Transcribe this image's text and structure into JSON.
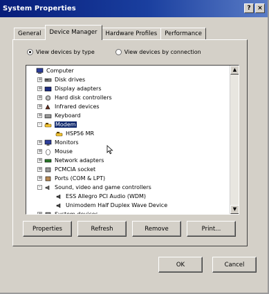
{
  "window": {
    "title": "System Properties",
    "help_label": "?",
    "close_label": "×"
  },
  "tabs": [
    {
      "label": "General"
    },
    {
      "label": "Device Manager"
    },
    {
      "label": "Hardware Profiles"
    },
    {
      "label": "Performance"
    }
  ],
  "view": {
    "by_type": "View devices by type",
    "by_connection": "View devices by connection"
  },
  "tree": {
    "items": [
      {
        "label": "Computer",
        "icon": "computer-icon",
        "expander": ""
      },
      {
        "label": "Disk drives",
        "icon": "disk-drive-icon",
        "expander": "+"
      },
      {
        "label": "Display adapters",
        "icon": "display-adapter-icon",
        "expander": "+"
      },
      {
        "label": "Hard disk controllers",
        "icon": "hard-disk-controller-icon",
        "expander": "+"
      },
      {
        "label": "Infrared devices",
        "icon": "infrared-icon",
        "expander": "+"
      },
      {
        "label": "Keyboard",
        "icon": "keyboard-icon",
        "expander": "+"
      },
      {
        "label": "Modem",
        "icon": "modem-icon",
        "expander": "-",
        "selected": true
      },
      {
        "label": "HSP56 MR",
        "icon": "modem-icon",
        "expander": ""
      },
      {
        "label": "Monitors",
        "icon": "monitor-icon",
        "expander": "+"
      },
      {
        "label": "Mouse",
        "icon": "mouse-icon",
        "expander": "+"
      },
      {
        "label": "Network adapters",
        "icon": "network-adapter-icon",
        "expander": "+"
      },
      {
        "label": "PCMCIA socket",
        "icon": "pcmcia-icon",
        "expander": "+"
      },
      {
        "label": "Ports (COM & LPT)",
        "icon": "port-icon",
        "expander": "+"
      },
      {
        "label": "Sound, video and game controllers",
        "icon": "sound-icon",
        "expander": "-"
      },
      {
        "label": "ESS Allegro PCI Audio (WDM)",
        "icon": "sound-device-icon",
        "expander": ""
      },
      {
        "label": "Unimodem Half Duplex Wave Device",
        "icon": "sound-device-icon",
        "expander": ""
      },
      {
        "label": "System devices",
        "icon": "system-device-icon",
        "expander": "+"
      }
    ]
  },
  "actions": {
    "properties": "Properties",
    "refresh": "Refresh",
    "remove": "Remove",
    "print": "Print..."
  },
  "dialog": {
    "ok": "OK",
    "cancel": "Cancel"
  },
  "colors": {
    "selection": "#0a246a",
    "title_bar": "#0a246a"
  }
}
